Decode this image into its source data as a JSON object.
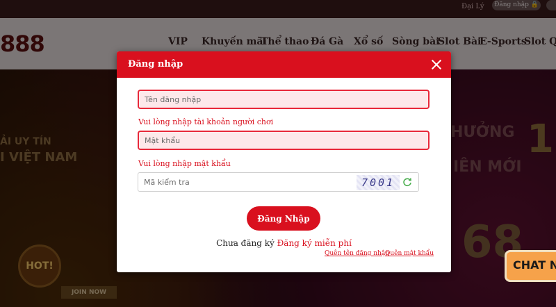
{
  "topbar": {
    "agency_label": "Đại Lý",
    "login_label": "Đăng nhập 🔒"
  },
  "brand": {
    "logo_text": "888"
  },
  "nav": {
    "items": [
      "VIP",
      "Khuyến mãi",
      "Thể thao",
      "Đá Gà",
      "Xổ số",
      "Sòng bài",
      "Slot Bài",
      "E-Sports",
      "Slot Quay"
    ]
  },
  "banner": {
    "left_line1": "ẢI UY TÍN",
    "left_line2": "I VIỆT NAM",
    "right_line1": "HƯỞNG",
    "right_line2": "IÊN MỚI",
    "right_big": "1",
    "right_big2": "68",
    "hot_label": "HOT!",
    "join_label": "JOIN NOW"
  },
  "chat": {
    "label": "CHAT N"
  },
  "modal": {
    "title": "Đăng nhập",
    "username_placeholder": "Tên đăng nhập",
    "username_error": "Vui lòng nhập tài khoản người chơi",
    "password_placeholder": "Mật khẩu",
    "password_error": "Vui lòng nhập mật khẩu",
    "captcha_placeholder": "Mã kiểm tra",
    "captcha_code": "7001",
    "submit_label": "Đăng Nhập",
    "signup_prompt": "Chưa đăng ký",
    "signup_link": "Đăng ký miễn phí",
    "forgot_username": "Quên tên đăng nhập",
    "forgot_password": "Quên mật khẩu"
  },
  "colors": {
    "accent": "#d9101e",
    "error_bg": "#fde8ea",
    "chat": "#f6a24a"
  }
}
